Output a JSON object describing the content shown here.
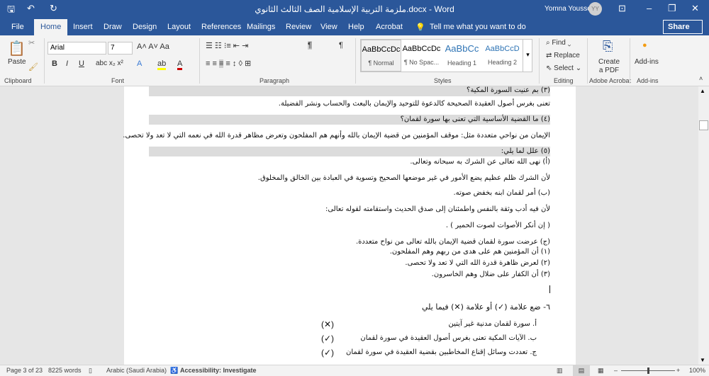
{
  "title": "ملزمة التربية الإسلامية الصف الثالث الثانوي.docx - Word",
  "user": {
    "name": "Yomna Youssef",
    "initials": "YY"
  },
  "tabs": [
    "File",
    "Home",
    "Insert",
    "Draw",
    "Design",
    "Layout",
    "References",
    "Mailings",
    "Review",
    "View",
    "Help",
    "Acrobat"
  ],
  "tell_me": "Tell me what you want to do",
  "share": "Share",
  "ribbon": {
    "paste": "Paste",
    "font_name": "Arial",
    "font_size": "7",
    "styles": [
      {
        "preview": "AaBbCcDc",
        "name": "¶ Normal"
      },
      {
        "preview": "AaBbCcDc",
        "name": "¶ No Spac..."
      },
      {
        "preview": "AaBbCc",
        "name": "Heading 1"
      },
      {
        "preview": "AaBbCcD",
        "name": "Heading 2"
      }
    ],
    "find": "Find",
    "replace": "Replace",
    "select": "Select",
    "create_pdf": "Create a PDF",
    "addins": "Add-ins",
    "groups": [
      "Clipboard",
      "Font",
      "Paragraph",
      "Styles",
      "Editing",
      "Adobe Acrobat",
      "Add-ins"
    ]
  },
  "doc": {
    "q3": "(٣) بم عنيت السورة المكية؟",
    "a3": "تعنى بغرس أصول العقيدة الصحيحة كالدعوة للتوحيد والإيمان بالبعث والحساب ونشر الفضيلة.",
    "q4": "(٤) ما القضية الأساسية التي تعنى بها سورة لقمان؟",
    "a4": "الإيمان من نواحي متعددة مثل: موقف المؤمنين من قضية الإيمان بالله وأنهم هم المفلحون وتعرض مظاهر قدرة الله في نعمه التي لا تعد ولا تحصى.",
    "q5": "(٥) علل لما يلي:",
    "l1": "(أ)  نهى الله تعالى عن الشرك به سبحانه وتعالى.",
    "l2": "لأن الشرك ظلم عظيم يضع الأمور في غير موضعها الصحيح وتسوية في العبادة بين الخالق والمخلوق.",
    "l3": "(ب) أمر لقمان ابنه بخفض صوته.",
    "l4": "لأن فيه أدب وثقة بالنفس واطمئنان إلى صدق الحديث واستقامته لقوله تعالى:",
    "l5": "( إن أنكر الأصوات لصوت الحمير ) .",
    "l6": "(ج) عرضت سورة لقمان قضية الإيمان بالله تعالى من نواح متعددة.",
    "l7": "(١) أن المؤمنين هم على هدى من ربهم وهم المفلحون.",
    "l8": "(٢) لعرض ظاهرة قدرة الله التي لا تعد ولا تحصى.",
    "l9": "(٣) أن الكفار على ضلال وهم الخاسرون.",
    "q6": "٦- ضع علامة (✓) أو علامة (✕) فيما يلي",
    "items": [
      {
        "text": "أ.   سورة لقمان مدنية غير آيتين",
        "mark": "(✕)"
      },
      {
        "text": "ب.   الآيات المكية تعنى بغرس أصول العقيدة في سورة لقمان",
        "mark": "(✓)"
      },
      {
        "text": "ج.   تعددت وسائل إقناع المخاطبين بقضية العقيدة في سورة لقمان",
        "mark": "(✓)"
      }
    ]
  },
  "status": {
    "page": "Page 3 of 23",
    "words": "8225 words",
    "language": "Arabic (Saudi Arabia)",
    "accessibility": "Accessibility: Investigate",
    "zoom": "100%"
  }
}
